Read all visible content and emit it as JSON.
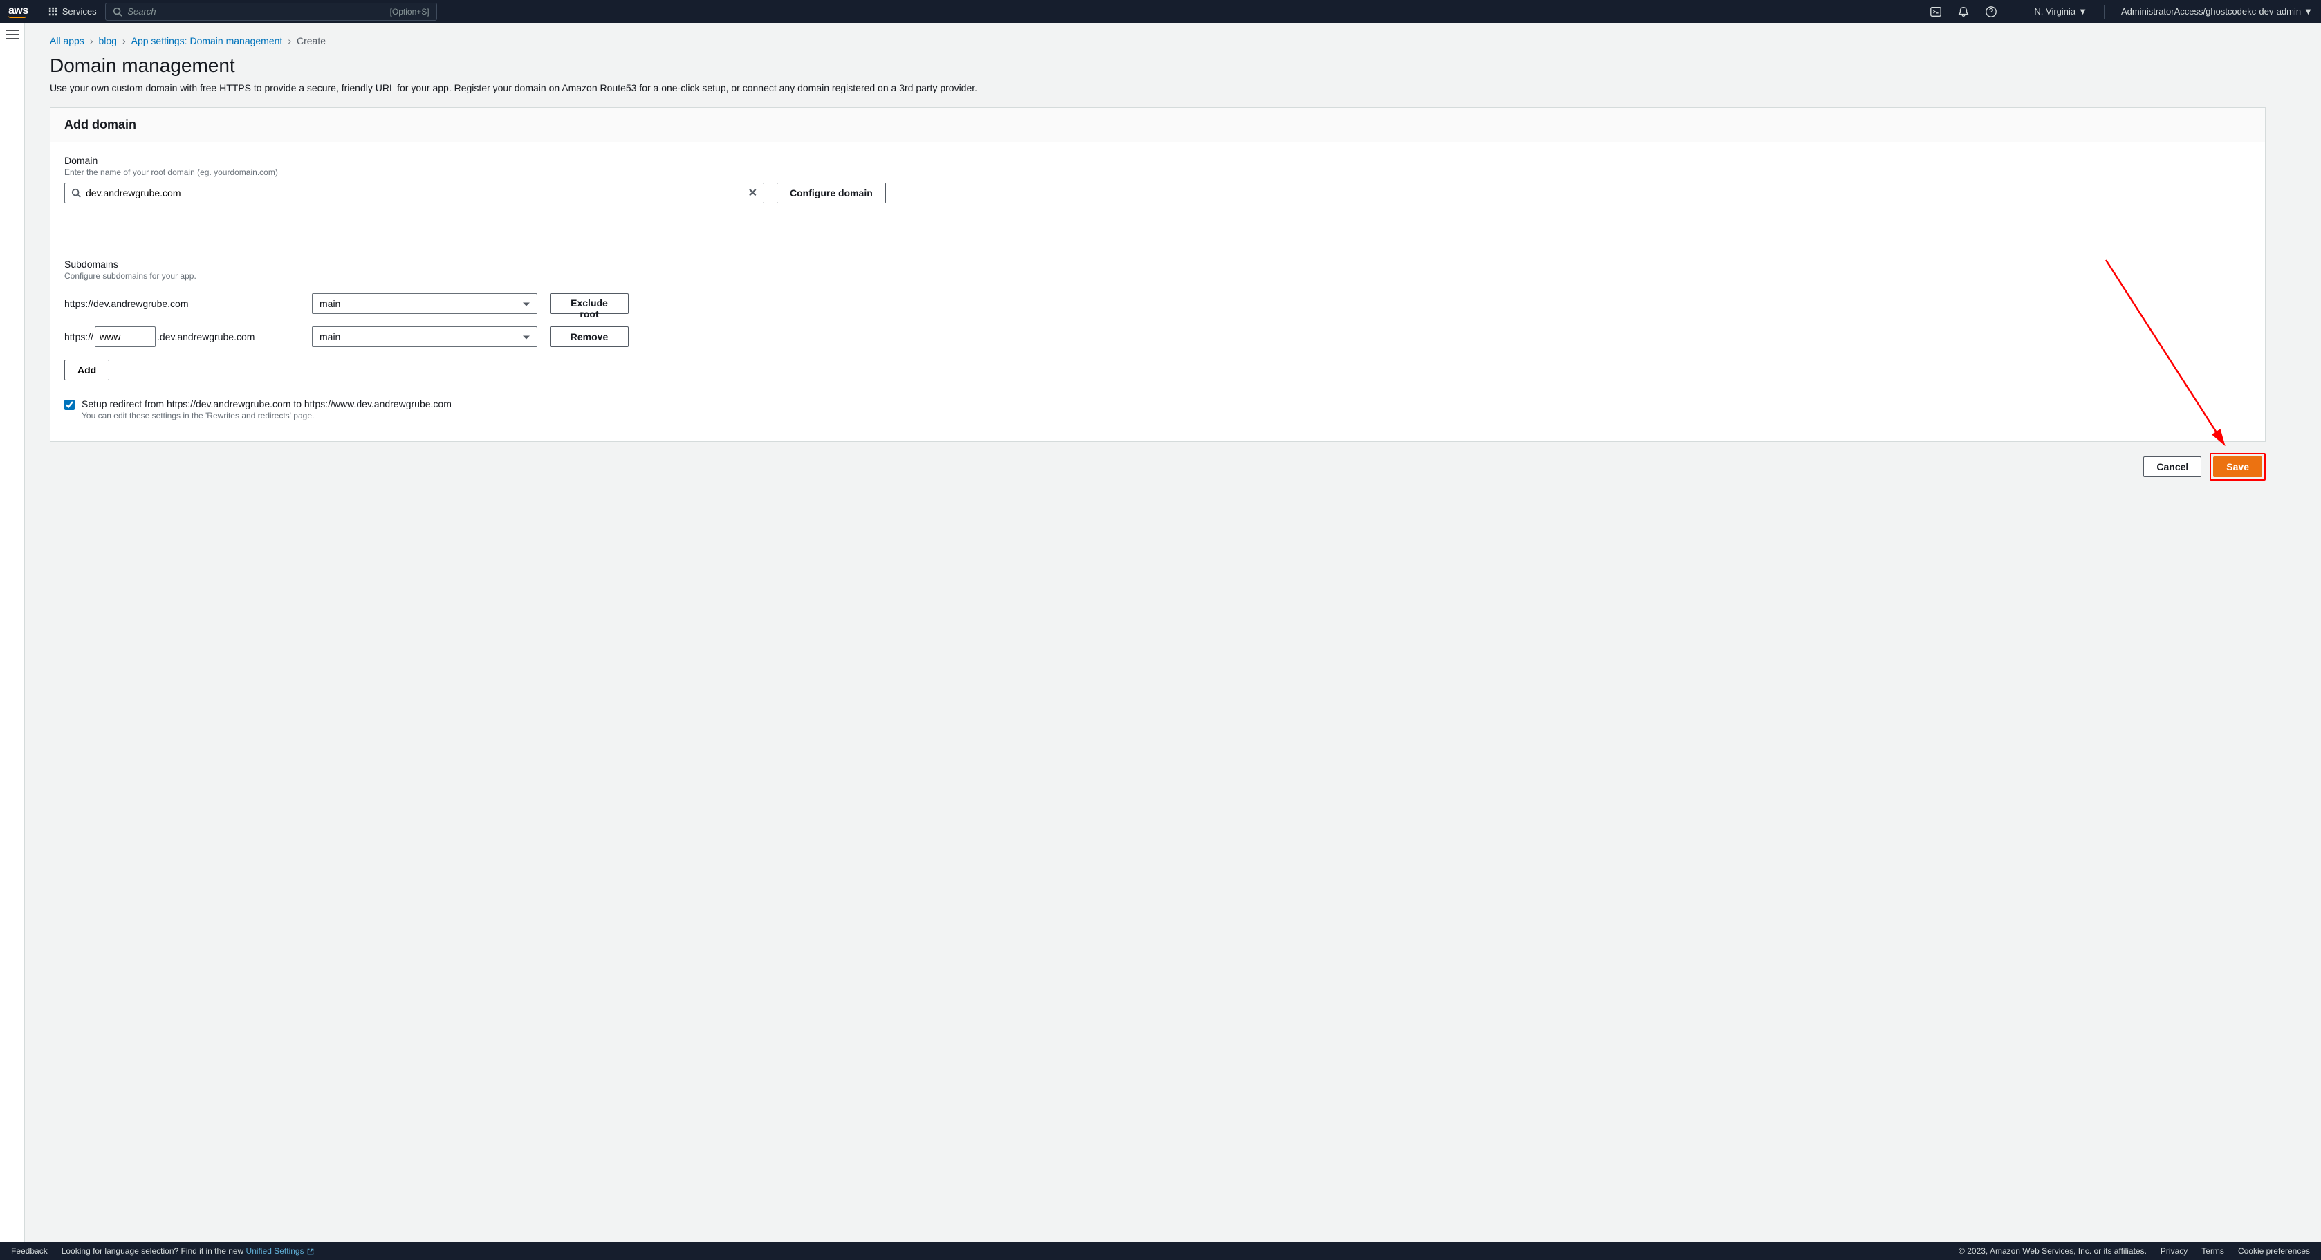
{
  "nav": {
    "logo": "aws",
    "services": "Services",
    "searchPlaceholder": "Search",
    "searchShortcut": "[Option+S]",
    "region": "N. Virginia",
    "account": "AdministratorAccess/ghostcodekc-dev-admin"
  },
  "breadcrumb": [
    {
      "label": "All apps",
      "link": true
    },
    {
      "label": "blog",
      "link": true
    },
    {
      "label": "App settings: Domain management",
      "link": true
    },
    {
      "label": "Create",
      "link": false
    }
  ],
  "page": {
    "title": "Domain management",
    "description": "Use your own custom domain with free HTTPS to provide a secure, friendly URL for your app. Register your domain on Amazon Route53 for a one-click setup, or connect any domain registered on a 3rd party provider."
  },
  "addDomain": {
    "cardTitle": "Add domain",
    "domainLabel": "Domain",
    "domainHint": "Enter the name of your root domain (eg. yourdomain.com)",
    "domainValue": "dev.andrewgrube.com",
    "configureButton": "Configure domain",
    "subdomainsLabel": "Subdomains",
    "subdomainsHint": "Configure subdomains for your app.",
    "rows": [
      {
        "urlDisplay": "https://dev.andrewgrube.com",
        "branch": "main",
        "action": "Exclude root",
        "editable": false
      },
      {
        "urlPrefix": "https://",
        "subValue": "www",
        "urlSuffix": ".dev.andrewgrube.com",
        "branch": "main",
        "action": "Remove",
        "editable": true
      }
    ],
    "addButton": "Add",
    "redirectChecked": true,
    "redirectLabel": "Setup redirect from https://dev.andrewgrube.com to https://www.dev.andrewgrube.com",
    "redirectHint": "You can edit these settings in the 'Rewrites and redirects' page."
  },
  "actions": {
    "cancel": "Cancel",
    "save": "Save"
  },
  "footer": {
    "feedback": "Feedback",
    "langText": "Looking for language selection? Find it in the new ",
    "unifiedSettings": "Unified Settings",
    "copyright": "© 2023, Amazon Web Services, Inc. or its affiliates.",
    "privacy": "Privacy",
    "terms": "Terms",
    "cookies": "Cookie preferences"
  }
}
